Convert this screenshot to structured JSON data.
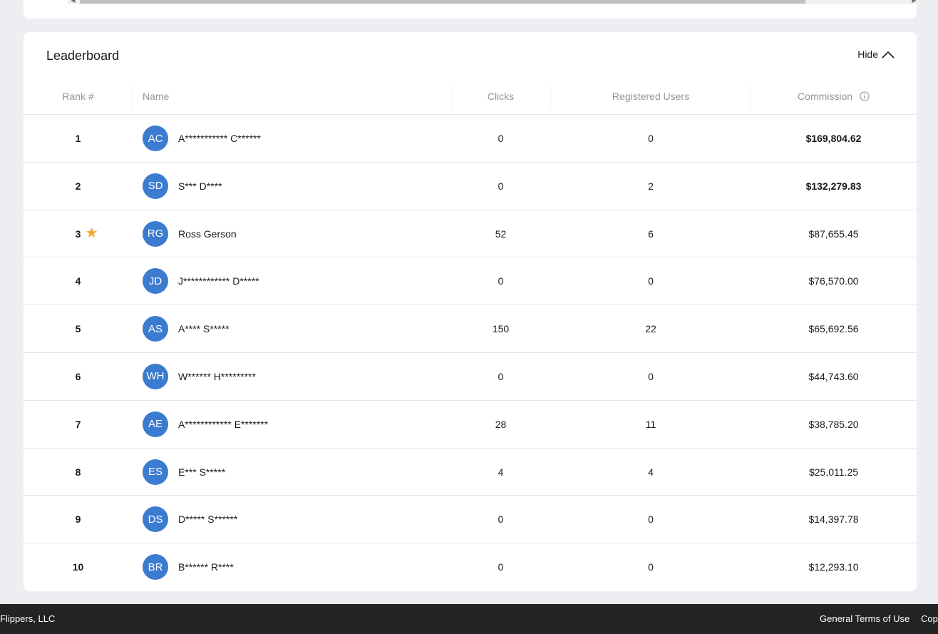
{
  "leaderboard": {
    "title": "Leaderboard",
    "hide_label": "Hide",
    "columns": {
      "rank": "Rank #",
      "name": "Name",
      "clicks": "Clicks",
      "registered_users": "Registered Users",
      "commission": "Commission"
    },
    "current_user_marker": "star-icon",
    "avatar_color": "#3b7bd0",
    "star_color": "#f4a524",
    "rows": [
      {
        "rank": "1",
        "initials": "AC",
        "name": "A*********** C******",
        "clicks": "0",
        "registered": "0",
        "commission": "$169,804.62",
        "current_user": false
      },
      {
        "rank": "2",
        "initials": "SD",
        "name": "S*** D****",
        "clicks": "0",
        "registered": "2",
        "commission": "$132,279.83",
        "current_user": false
      },
      {
        "rank": "3",
        "initials": "RG",
        "name": "Ross Gerson",
        "clicks": "52",
        "registered": "6",
        "commission": "$87,655.45",
        "current_user": true
      },
      {
        "rank": "4",
        "initials": "JD",
        "name": "J************ D*****",
        "clicks": "0",
        "registered": "0",
        "commission": "$76,570.00",
        "current_user": false
      },
      {
        "rank": "5",
        "initials": "AS",
        "name": "A**** S*****",
        "clicks": "150",
        "registered": "22",
        "commission": "$65,692.56",
        "current_user": false
      },
      {
        "rank": "6",
        "initials": "WH",
        "name": "W****** H*********",
        "clicks": "0",
        "registered": "0",
        "commission": "$44,743.60",
        "current_user": false
      },
      {
        "rank": "7",
        "initials": "AE",
        "name": "A************ E*******",
        "clicks": "28",
        "registered": "11",
        "commission": "$38,785.20",
        "current_user": false
      },
      {
        "rank": "8",
        "initials": "ES",
        "name": "E*** S*****",
        "clicks": "4",
        "registered": "4",
        "commission": "$25,011.25",
        "current_user": false
      },
      {
        "rank": "9",
        "initials": "DS",
        "name": "D***** S******",
        "clicks": "0",
        "registered": "0",
        "commission": "$14,397.78",
        "current_user": false
      },
      {
        "rank": "10",
        "initials": "BR",
        "name": "B****** R****",
        "clicks": "0",
        "registered": "0",
        "commission": "$12,293.10",
        "current_user": false
      }
    ]
  },
  "footer": {
    "company": "Flippers, LLC",
    "links": [
      "General Terms of Use",
      "Cop"
    ]
  }
}
